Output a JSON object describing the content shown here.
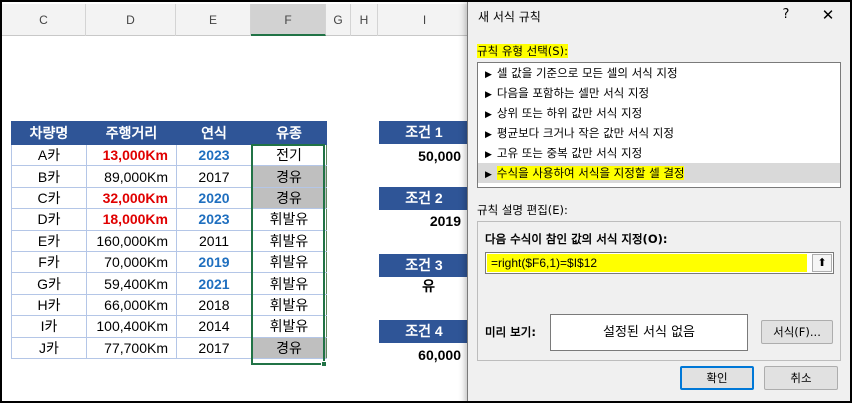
{
  "columns": [
    "C",
    "D",
    "E",
    "F",
    "G",
    "H",
    "I"
  ],
  "selected_column": "F",
  "table": {
    "headers": [
      "차량명",
      "주행거리",
      "연식",
      "유종"
    ],
    "rows": [
      {
        "name": "A카",
        "km": "13,000Km",
        "year": "2023",
        "fuel": "전기"
      },
      {
        "name": "B카",
        "km": "89,000Km",
        "year": "2017",
        "fuel": "경유"
      },
      {
        "name": "C카",
        "km": "32,000Km",
        "year": "2020",
        "fuel": "경유"
      },
      {
        "name": "D카",
        "km": "18,000Km",
        "year": "2023",
        "fuel": "휘발유"
      },
      {
        "name": "E카",
        "km": "160,000Km",
        "year": "2011",
        "fuel": "휘발유"
      },
      {
        "name": "F카",
        "km": "70,000Km",
        "year": "2019",
        "fuel": "휘발유"
      },
      {
        "name": "G카",
        "km": "59,400Km",
        "year": "2021",
        "fuel": "휘발유"
      },
      {
        "name": "H카",
        "km": "66,000Km",
        "year": "2018",
        "fuel": "휘발유"
      },
      {
        "name": "I카",
        "km": "100,400Km",
        "year": "2014",
        "fuel": "휘발유"
      },
      {
        "name": "J카",
        "km": "77,700Km",
        "year": "2017",
        "fuel": "경유"
      }
    ]
  },
  "conditions": [
    {
      "label": "조건 1",
      "value": "50,000"
    },
    {
      "label": "조건 2",
      "value": "2019"
    },
    {
      "label": "조건 3",
      "value": "유"
    },
    {
      "label": "조건 4",
      "value": "60,000"
    }
  ],
  "dialog": {
    "title": "새 서식 규칙",
    "help": "?",
    "close": "✕",
    "rule_type_label": "규칙 유형 선택(S):",
    "rule_types": [
      "셀 값을 기준으로 모든 셀의 서식 지정",
      "다음을 포함하는 셀만 서식 지정",
      "상위 또는 하위 값만 서식 지정",
      "평균보다 크거나 작은 값만 서식 지정",
      "고유 또는 중복 값만 서식 지정",
      "수식을 사용하여 서식을 지정할 셀 결정"
    ],
    "edit_label": "규칙 설명 편집(E):",
    "formula_label": "다음 수식이 참인 값의 서식 지정(O):",
    "formula_value": "=right($F6,1)=$I$12",
    "preview_label": "미리 보기:",
    "preview_text": "설정된 서식 없음",
    "format_button": "서식(F)...",
    "ok_button": "확인",
    "cancel_button": "취소"
  },
  "colors": {
    "header_blue": "#2f5597",
    "highlight_red": "#e00000",
    "highlight_blue": "#1f6fbf",
    "cell_gray": "#bfbfbf",
    "marker_yellow": "#ffff00",
    "selection_green": "#217346"
  }
}
